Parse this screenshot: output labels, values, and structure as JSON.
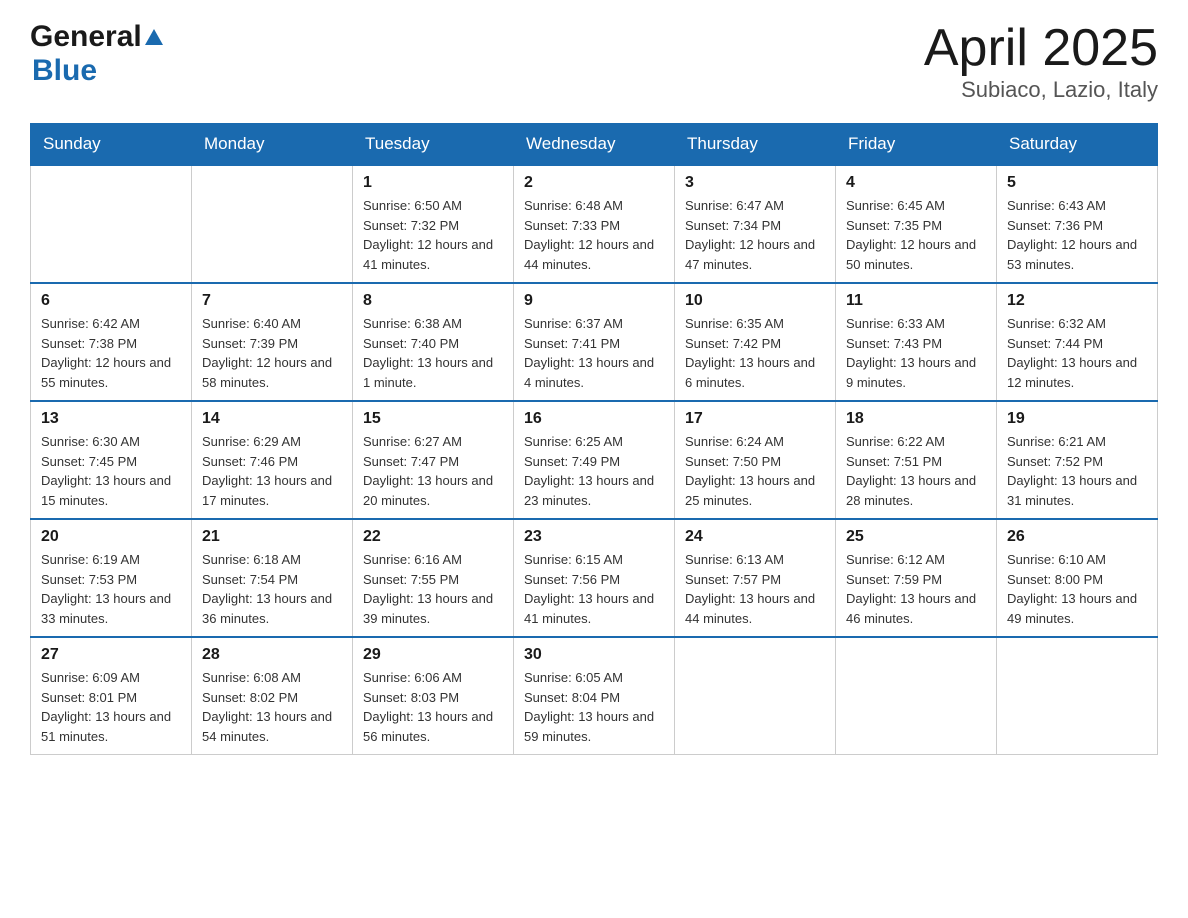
{
  "header": {
    "logo_general": "General",
    "logo_blue": "Blue",
    "title": "April 2025",
    "subtitle": "Subiaco, Lazio, Italy"
  },
  "days_of_week": [
    "Sunday",
    "Monday",
    "Tuesday",
    "Wednesday",
    "Thursday",
    "Friday",
    "Saturday"
  ],
  "weeks": [
    [
      {
        "day": "",
        "sunrise": "",
        "sunset": "",
        "daylight": ""
      },
      {
        "day": "",
        "sunrise": "",
        "sunset": "",
        "daylight": ""
      },
      {
        "day": "1",
        "sunrise": "Sunrise: 6:50 AM",
        "sunset": "Sunset: 7:32 PM",
        "daylight": "Daylight: 12 hours and 41 minutes."
      },
      {
        "day": "2",
        "sunrise": "Sunrise: 6:48 AM",
        "sunset": "Sunset: 7:33 PM",
        "daylight": "Daylight: 12 hours and 44 minutes."
      },
      {
        "day": "3",
        "sunrise": "Sunrise: 6:47 AM",
        "sunset": "Sunset: 7:34 PM",
        "daylight": "Daylight: 12 hours and 47 minutes."
      },
      {
        "day": "4",
        "sunrise": "Sunrise: 6:45 AM",
        "sunset": "Sunset: 7:35 PM",
        "daylight": "Daylight: 12 hours and 50 minutes."
      },
      {
        "day": "5",
        "sunrise": "Sunrise: 6:43 AM",
        "sunset": "Sunset: 7:36 PM",
        "daylight": "Daylight: 12 hours and 53 minutes."
      }
    ],
    [
      {
        "day": "6",
        "sunrise": "Sunrise: 6:42 AM",
        "sunset": "Sunset: 7:38 PM",
        "daylight": "Daylight: 12 hours and 55 minutes."
      },
      {
        "day": "7",
        "sunrise": "Sunrise: 6:40 AM",
        "sunset": "Sunset: 7:39 PM",
        "daylight": "Daylight: 12 hours and 58 minutes."
      },
      {
        "day": "8",
        "sunrise": "Sunrise: 6:38 AM",
        "sunset": "Sunset: 7:40 PM",
        "daylight": "Daylight: 13 hours and 1 minute."
      },
      {
        "day": "9",
        "sunrise": "Sunrise: 6:37 AM",
        "sunset": "Sunset: 7:41 PM",
        "daylight": "Daylight: 13 hours and 4 minutes."
      },
      {
        "day": "10",
        "sunrise": "Sunrise: 6:35 AM",
        "sunset": "Sunset: 7:42 PM",
        "daylight": "Daylight: 13 hours and 6 minutes."
      },
      {
        "day": "11",
        "sunrise": "Sunrise: 6:33 AM",
        "sunset": "Sunset: 7:43 PM",
        "daylight": "Daylight: 13 hours and 9 minutes."
      },
      {
        "day": "12",
        "sunrise": "Sunrise: 6:32 AM",
        "sunset": "Sunset: 7:44 PM",
        "daylight": "Daylight: 13 hours and 12 minutes."
      }
    ],
    [
      {
        "day": "13",
        "sunrise": "Sunrise: 6:30 AM",
        "sunset": "Sunset: 7:45 PM",
        "daylight": "Daylight: 13 hours and 15 minutes."
      },
      {
        "day": "14",
        "sunrise": "Sunrise: 6:29 AM",
        "sunset": "Sunset: 7:46 PM",
        "daylight": "Daylight: 13 hours and 17 minutes."
      },
      {
        "day": "15",
        "sunrise": "Sunrise: 6:27 AM",
        "sunset": "Sunset: 7:47 PM",
        "daylight": "Daylight: 13 hours and 20 minutes."
      },
      {
        "day": "16",
        "sunrise": "Sunrise: 6:25 AM",
        "sunset": "Sunset: 7:49 PM",
        "daylight": "Daylight: 13 hours and 23 minutes."
      },
      {
        "day": "17",
        "sunrise": "Sunrise: 6:24 AM",
        "sunset": "Sunset: 7:50 PM",
        "daylight": "Daylight: 13 hours and 25 minutes."
      },
      {
        "day": "18",
        "sunrise": "Sunrise: 6:22 AM",
        "sunset": "Sunset: 7:51 PM",
        "daylight": "Daylight: 13 hours and 28 minutes."
      },
      {
        "day": "19",
        "sunrise": "Sunrise: 6:21 AM",
        "sunset": "Sunset: 7:52 PM",
        "daylight": "Daylight: 13 hours and 31 minutes."
      }
    ],
    [
      {
        "day": "20",
        "sunrise": "Sunrise: 6:19 AM",
        "sunset": "Sunset: 7:53 PM",
        "daylight": "Daylight: 13 hours and 33 minutes."
      },
      {
        "day": "21",
        "sunrise": "Sunrise: 6:18 AM",
        "sunset": "Sunset: 7:54 PM",
        "daylight": "Daylight: 13 hours and 36 minutes."
      },
      {
        "day": "22",
        "sunrise": "Sunrise: 6:16 AM",
        "sunset": "Sunset: 7:55 PM",
        "daylight": "Daylight: 13 hours and 39 minutes."
      },
      {
        "day": "23",
        "sunrise": "Sunrise: 6:15 AM",
        "sunset": "Sunset: 7:56 PM",
        "daylight": "Daylight: 13 hours and 41 minutes."
      },
      {
        "day": "24",
        "sunrise": "Sunrise: 6:13 AM",
        "sunset": "Sunset: 7:57 PM",
        "daylight": "Daylight: 13 hours and 44 minutes."
      },
      {
        "day": "25",
        "sunrise": "Sunrise: 6:12 AM",
        "sunset": "Sunset: 7:59 PM",
        "daylight": "Daylight: 13 hours and 46 minutes."
      },
      {
        "day": "26",
        "sunrise": "Sunrise: 6:10 AM",
        "sunset": "Sunset: 8:00 PM",
        "daylight": "Daylight: 13 hours and 49 minutes."
      }
    ],
    [
      {
        "day": "27",
        "sunrise": "Sunrise: 6:09 AM",
        "sunset": "Sunset: 8:01 PM",
        "daylight": "Daylight: 13 hours and 51 minutes."
      },
      {
        "day": "28",
        "sunrise": "Sunrise: 6:08 AM",
        "sunset": "Sunset: 8:02 PM",
        "daylight": "Daylight: 13 hours and 54 minutes."
      },
      {
        "day": "29",
        "sunrise": "Sunrise: 6:06 AM",
        "sunset": "Sunset: 8:03 PM",
        "daylight": "Daylight: 13 hours and 56 minutes."
      },
      {
        "day": "30",
        "sunrise": "Sunrise: 6:05 AM",
        "sunset": "Sunset: 8:04 PM",
        "daylight": "Daylight: 13 hours and 59 minutes."
      },
      {
        "day": "",
        "sunrise": "",
        "sunset": "",
        "daylight": ""
      },
      {
        "day": "",
        "sunrise": "",
        "sunset": "",
        "daylight": ""
      },
      {
        "day": "",
        "sunrise": "",
        "sunset": "",
        "daylight": ""
      }
    ]
  ]
}
